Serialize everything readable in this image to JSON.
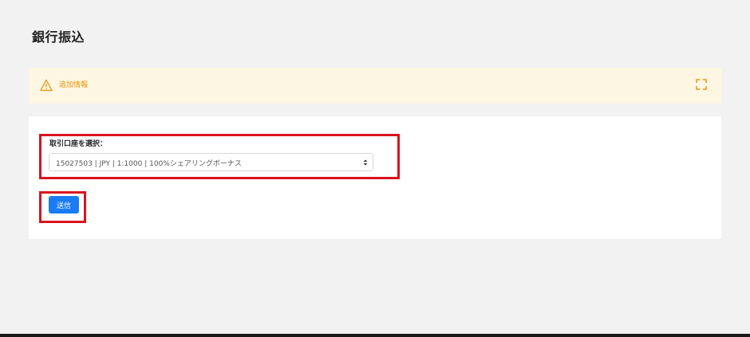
{
  "page": {
    "title": "銀行振込"
  },
  "info_bar": {
    "label": "追加情報",
    "icon": "warning-triangle-icon",
    "expand_icon": "expand-icon",
    "accent_color": "#e8960f",
    "background_color": "#fdf6e2"
  },
  "form": {
    "account_label": "取引口座を選択：",
    "account_selected": "15027503 | JPY | 1:1000 | 100%シェアリングボーナス",
    "submit_label": "送信",
    "submit_color": "#1a7cf5",
    "highlight_color": "#d9141e"
  }
}
